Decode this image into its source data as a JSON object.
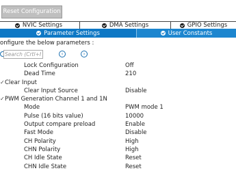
{
  "toolbar": {
    "reset_label": "Reset Configuration"
  },
  "tabs_row1": [
    {
      "label": "NVIC Settings"
    },
    {
      "label": "DMA Settings"
    },
    {
      "label": "GPIO Settings"
    }
  ],
  "tabs_row2": [
    {
      "label": "Parameter Settings",
      "active": true
    },
    {
      "label": "User Constants"
    }
  ],
  "config_text": "onfigure the below parameters :",
  "search": {
    "placeholder": "Search (Crtl+F)",
    "prev": "‹",
    "next": "›"
  },
  "params": {
    "pre": [
      {
        "name": "Lock Configuration",
        "value": "Off"
      },
      {
        "name": "Dead Time",
        "value": "210"
      }
    ],
    "clear_input": {
      "title": "Clear Input",
      "items": [
        {
          "name": "Clear Input Source",
          "value": "Disable"
        }
      ]
    },
    "pwm": {
      "title": "PWM Generation Channel 1 and 1N",
      "items": [
        {
          "name": "Mode",
          "value": "PWM mode 1"
        },
        {
          "name": "Pulse (16 bits value)",
          "value": "10000"
        },
        {
          "name": "Output compare preload",
          "value": "Enable"
        },
        {
          "name": "Fast Mode",
          "value": "Disable"
        },
        {
          "name": "CH Polarity",
          "value": "High"
        },
        {
          "name": "CHN Polarity",
          "value": "High"
        },
        {
          "name": "CH Idle State",
          "value": "Reset"
        },
        {
          "name": "CHN Idle State",
          "value": "Reset"
        }
      ]
    }
  }
}
